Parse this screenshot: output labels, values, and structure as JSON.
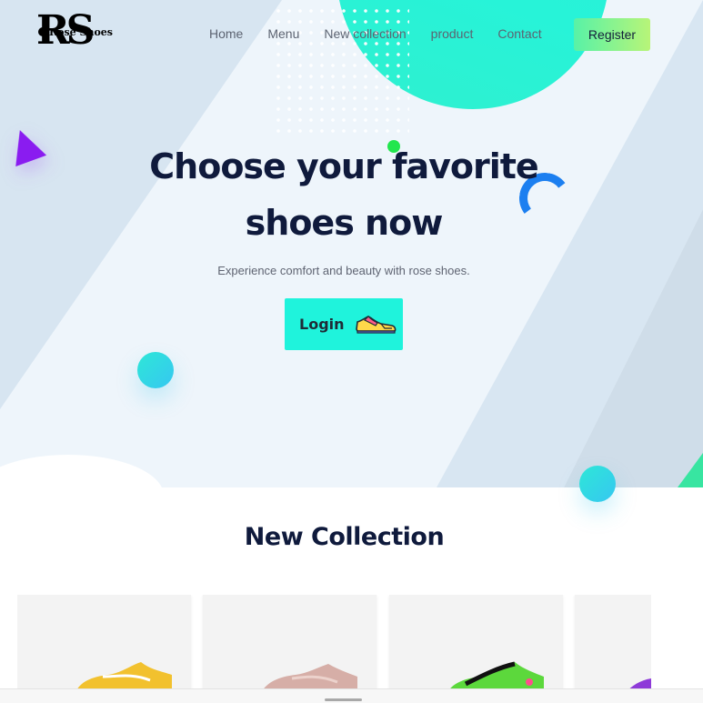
{
  "brand": {
    "logo_initials": "RS",
    "logo_name": "Rose Shoes"
  },
  "nav": {
    "items": [
      "Home",
      "Menu",
      "New collection",
      "product",
      "Contact"
    ],
    "register_label": "Register"
  },
  "hero": {
    "headline_line1": "Choose your favorite",
    "headline_line2": "shoes now",
    "subtitle": "Experience comfort and beauty with rose shoes.",
    "login_label": "Login"
  },
  "collection": {
    "title": "New Collection"
  },
  "colors": {
    "accent": "#1ff3dc",
    "register_gradient": [
      "#58f2a7",
      "#b8f478"
    ],
    "headline": "#0f1a3c",
    "triangle": "#8a1cf0",
    "arc": "#1c7ff0"
  }
}
